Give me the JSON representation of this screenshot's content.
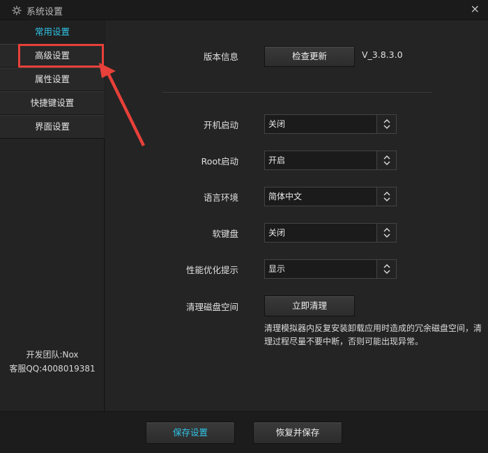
{
  "window": {
    "title": "系统设置",
    "close_label": "×"
  },
  "sidebar": {
    "items": [
      {
        "label": "常用设置",
        "active": true
      },
      {
        "label": "高级设置",
        "active": false
      },
      {
        "label": "属性设置",
        "active": false
      },
      {
        "label": "快捷键设置",
        "active": false
      },
      {
        "label": "界面设置",
        "active": false
      }
    ],
    "team": "开发团队:Nox",
    "support": "客服QQ:4008019381"
  },
  "settings": {
    "version_label": "版本信息",
    "check_update": "检查更新",
    "version_value": "V_3.8.3.0",
    "boot_start_label": "开机启动",
    "boot_start_value": "关闭",
    "root_label": "Root启动",
    "root_value": "开启",
    "language_label": "语言环境",
    "language_value": "简体中文",
    "softkeyboard_label": "软键盘",
    "softkeyboard_value": "关闭",
    "perf_tip_label": "性能优化提示",
    "perf_tip_value": "显示",
    "disk_clean_label": "清理磁盘空间",
    "disk_clean_button": "立即清理",
    "disk_clean_note": "清理模拟器内反复安装卸载应用时造成的冗余磁盘空间，清理过程尽量不要中断，否则可能出现异常。"
  },
  "footer": {
    "save": "保存设置",
    "restore": "恢复并保存"
  },
  "colors": {
    "accent": "#2fc4e8",
    "highlight": "#e8403a"
  }
}
